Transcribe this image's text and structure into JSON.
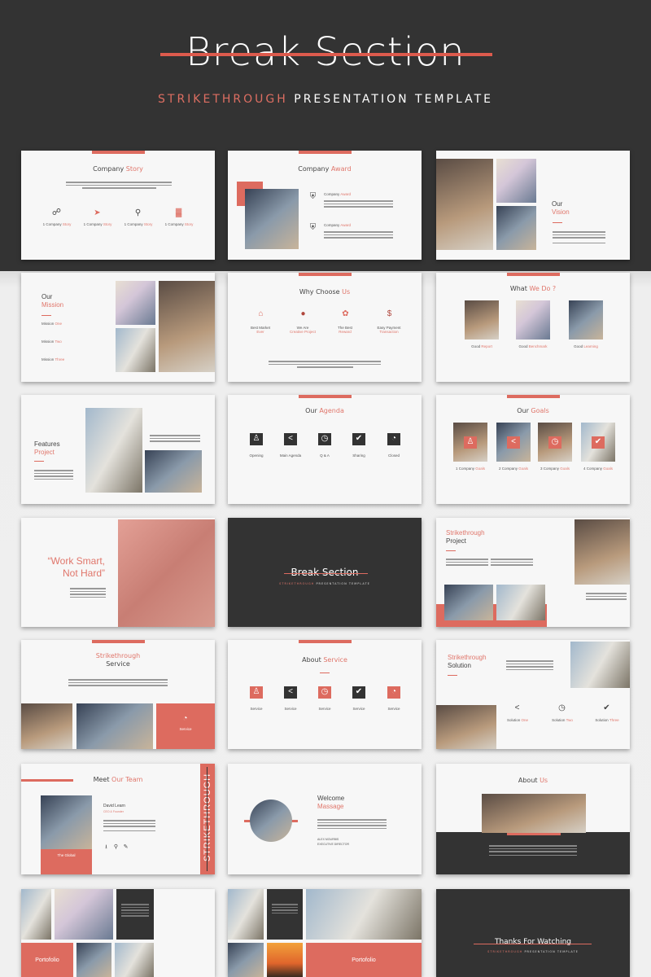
{
  "hero": {
    "title": "Break Section",
    "subtitle_accent": "STRIKETHROUGH",
    "subtitle_rest": "PRESENTATION TEMPLATE",
    "accent_color": "#dd5b4d",
    "background_color": "#333333"
  },
  "slides": {
    "company_story": {
      "title": "Company",
      "title_accent": "Story",
      "items": [
        {
          "icon": "link-icon",
          "label": "1 Company",
          "accent": "Story"
        },
        {
          "icon": "pin-icon",
          "label": "1 Company",
          "accent": "Story"
        },
        {
          "icon": "search-icon",
          "label": "1 Company",
          "accent": "Story"
        },
        {
          "icon": "bar-chart-icon",
          "label": "1 Company",
          "accent": "Story"
        }
      ]
    },
    "company_award": {
      "title": "Company",
      "title_accent": "Award",
      "items": [
        {
          "icon": "trophy-icon",
          "label": "Company",
          "accent": "Award"
        },
        {
          "icon": "trophy-icon",
          "label": "Company",
          "accent": "Award"
        }
      ]
    },
    "our_vision": {
      "title": "Our",
      "title_accent": "Vision"
    },
    "our_mission": {
      "title": "Our",
      "title_accent": "Mission",
      "items": [
        {
          "label": "Mission",
          "accent": "One"
        },
        {
          "label": "Mission",
          "accent": "Two"
        },
        {
          "label": "Mission",
          "accent": "Three"
        }
      ]
    },
    "why_choose_us": {
      "title": "Why Choose",
      "title_accent": "Us",
      "items": [
        {
          "icon": "home-icon",
          "label": "Best Market",
          "accent": "Ever"
        },
        {
          "icon": "lightbulb-icon",
          "label": "We Are",
          "accent": "Creative Project"
        },
        {
          "icon": "award-icon",
          "label": "The Best",
          "accent": "Reward"
        },
        {
          "icon": "money-bag-icon",
          "label": "Easy Payment",
          "accent": "Transaction"
        }
      ]
    },
    "what_we_do": {
      "title": "What",
      "title_accent": "We Do ?",
      "items": [
        {
          "label": "Good",
          "accent": "Report"
        },
        {
          "label": "Good",
          "accent": "Benchmark"
        },
        {
          "label": "Good",
          "accent": "Learning"
        }
      ]
    },
    "features_project": {
      "title": "Features",
      "title_accent": "Project"
    },
    "our_agenda": {
      "title": "Our",
      "title_accent": "Agenda",
      "items": [
        {
          "icon": "group-icon",
          "label": "Opening"
        },
        {
          "icon": "share-icon",
          "label": "Main Agenda"
        },
        {
          "icon": "clock-icon",
          "label": "Q & A"
        },
        {
          "icon": "check-icon",
          "label": "Sharing"
        },
        {
          "icon": "pie-chart-icon",
          "label": "Closed"
        }
      ]
    },
    "our_goals": {
      "title": "Our",
      "title_accent": "Goals",
      "items": [
        {
          "icon": "group-icon",
          "label": "1 Company",
          "accent": "Goals"
        },
        {
          "icon": "share-icon",
          "label": "2 Company",
          "accent": "Goals"
        },
        {
          "icon": "clock-icon",
          "label": "3 Company",
          "accent": "Goals"
        },
        {
          "icon": "check-icon",
          "label": "4 Company",
          "accent": "Goals"
        }
      ]
    },
    "quote": {
      "line1": "“Work Smart,",
      "line2": "Not Hard”"
    },
    "break_section": {
      "title": "Break Section",
      "subtitle_accent": "STRIKETHROUGH",
      "subtitle_rest": "PRESENTATION TEMPLATE"
    },
    "strikethrough_project": {
      "title_accent": "Strikethrough",
      "title": "Project"
    },
    "strikethrough_service": {
      "title_accent": "Strikethrough",
      "title": "Service",
      "box_label": "Service"
    },
    "about_service": {
      "title": "About",
      "title_accent": "Service",
      "items": [
        {
          "icon": "group-icon",
          "label": "Service"
        },
        {
          "icon": "share-icon",
          "label": "Service"
        },
        {
          "icon": "clock-icon",
          "label": "Service"
        },
        {
          "icon": "check-icon",
          "label": "Service"
        },
        {
          "icon": "pie-chart-icon",
          "label": "Service"
        }
      ]
    },
    "strikethrough_solution": {
      "title_accent": "Strikethrough",
      "title": "Solution",
      "items": [
        {
          "icon": "share-icon",
          "label": "Solution",
          "accent": "One"
        },
        {
          "icon": "clock-icon",
          "label": "Solution",
          "accent": "Two"
        },
        {
          "icon": "check-icon",
          "label": "Solution",
          "accent": "Three"
        }
      ]
    },
    "meet_team": {
      "title": "Meet",
      "title_accent": "Our Team",
      "name": "David Learn",
      "role": "CEO & Founder",
      "card_label": "The Global",
      "side_text": "STRIKETHROUGH"
    },
    "welcome": {
      "title": "Welcome",
      "title_accent": "Massage",
      "signer": "ALEX MOURBIS",
      "signer_role": "EXECUTIVE DIRECTOR"
    },
    "about_us": {
      "title": "About",
      "title_accent": "Us"
    },
    "portfolio_1": {
      "label": "Portofolio"
    },
    "portfolio_2": {
      "label": "Portofolio"
    },
    "thanks": {
      "title": "Thanks For Watching",
      "subtitle_accent": "STRIKETHROUGH",
      "subtitle_rest": "PRESENTATION TEMPLATE"
    }
  }
}
